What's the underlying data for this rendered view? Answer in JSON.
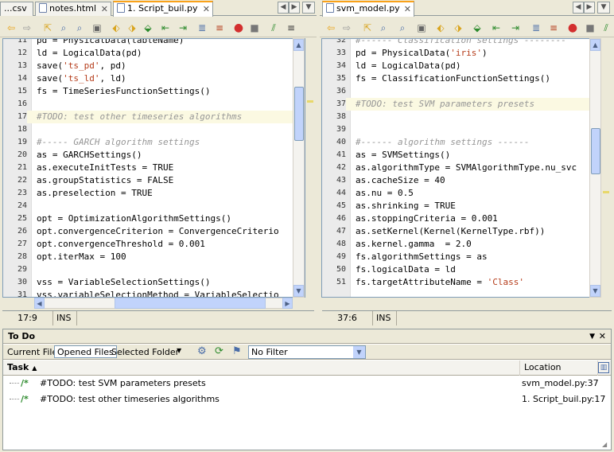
{
  "left": {
    "tabs": [
      "...csv",
      "notes.html",
      "1. Script_buil.py"
    ],
    "active_tab": 2,
    "lines": [
      {
        "n": "11",
        "t": [
          [
            "pd = PhysicalData(tableName)",
            ""
          ]
        ]
      },
      {
        "n": "12",
        "t": [
          [
            "ld = LogicalData(pd)",
            ""
          ]
        ]
      },
      {
        "n": "13",
        "t": [
          [
            "save(",
            ""
          ],
          [
            "'ts_pd'",
            "str"
          ],
          [
            ", pd)",
            ""
          ]
        ]
      },
      {
        "n": "14",
        "t": [
          [
            "save(",
            ""
          ],
          [
            "'ts_ld'",
            "str"
          ],
          [
            ", ld)",
            ""
          ]
        ]
      },
      {
        "n": "15",
        "t": [
          [
            "fs = TimeSeriesFunctionSettings()",
            ""
          ]
        ]
      },
      {
        "n": "16",
        "t": [
          [
            "",
            ""
          ]
        ]
      },
      {
        "n": "17",
        "t": [
          [
            "#TODO: test other timeseries algorithms",
            "cm"
          ]
        ],
        "hl": true
      },
      {
        "n": "18",
        "t": [
          [
            "",
            ""
          ]
        ]
      },
      {
        "n": "19",
        "t": [
          [
            "#----- GARCH algorithm settings",
            "cm"
          ]
        ]
      },
      {
        "n": "20",
        "t": [
          [
            "as = GARCHSettings()",
            ""
          ]
        ]
      },
      {
        "n": "21",
        "t": [
          [
            "as.executeInitTests = TRUE",
            ""
          ]
        ]
      },
      {
        "n": "22",
        "t": [
          [
            "as.groupStatistics = FALSE",
            ""
          ]
        ]
      },
      {
        "n": "23",
        "t": [
          [
            "as.preselection = TRUE",
            ""
          ]
        ]
      },
      {
        "n": "24",
        "t": [
          [
            "",
            ""
          ]
        ]
      },
      {
        "n": "25",
        "t": [
          [
            "opt = OptimizationAlgorithmSettings()",
            ""
          ]
        ]
      },
      {
        "n": "26",
        "t": [
          [
            "opt.convergenceCriterion = ConvergenceCriterio",
            ""
          ]
        ]
      },
      {
        "n": "27",
        "t": [
          [
            "opt.convergenceThreshold = 0.001",
            ""
          ]
        ]
      },
      {
        "n": "28",
        "t": [
          [
            "opt.iterMax = 100",
            ""
          ]
        ]
      },
      {
        "n": "29",
        "t": [
          [
            "",
            ""
          ]
        ]
      },
      {
        "n": "30",
        "t": [
          [
            "vss = VariableSelectionSettings()",
            ""
          ]
        ]
      },
      {
        "n": "31",
        "t": [
          [
            "vss.variableSelectionMethod = VariableSelectio",
            ""
          ]
        ]
      }
    ],
    "status": {
      "pos": "17:9",
      "mode": "INS"
    }
  },
  "right": {
    "tabs": [
      "svm_model.py"
    ],
    "active_tab": 0,
    "lines": [
      {
        "n": "32",
        "t": [
          [
            "#------ Classification settings --------",
            "cm"
          ]
        ]
      },
      {
        "n": "33",
        "t": [
          [
            "pd = PhysicalData(",
            ""
          ],
          [
            "'iris'",
            "str"
          ],
          [
            ")",
            ""
          ]
        ]
      },
      {
        "n": "34",
        "t": [
          [
            "ld = LogicalData(pd)",
            ""
          ]
        ]
      },
      {
        "n": "35",
        "t": [
          [
            "fs = ClassificationFunctionSettings()",
            ""
          ]
        ]
      },
      {
        "n": "36",
        "t": [
          [
            "",
            ""
          ]
        ]
      },
      {
        "n": "37",
        "t": [
          [
            "#TODO: test SVM parameters presets",
            "cm"
          ]
        ],
        "hl": true
      },
      {
        "n": "38",
        "t": [
          [
            "",
            ""
          ]
        ]
      },
      {
        "n": "39",
        "t": [
          [
            "",
            ""
          ]
        ]
      },
      {
        "n": "40",
        "t": [
          [
            "#------ algorithm settings ------",
            "cm"
          ]
        ]
      },
      {
        "n": "41",
        "t": [
          [
            "as = SVMSettings()",
            ""
          ]
        ]
      },
      {
        "n": "42",
        "t": [
          [
            "as.algorithmType = SVMAlgorithmType.nu_svc",
            ""
          ]
        ]
      },
      {
        "n": "43",
        "t": [
          [
            "as.cacheSize = 40",
            ""
          ]
        ]
      },
      {
        "n": "44",
        "t": [
          [
            "as.nu = 0.5",
            ""
          ]
        ]
      },
      {
        "n": "45",
        "t": [
          [
            "as.shrinking = TRUE",
            ""
          ]
        ]
      },
      {
        "n": "46",
        "t": [
          [
            "as.stoppingCriteria = 0.001",
            ""
          ]
        ]
      },
      {
        "n": "47",
        "t": [
          [
            "as.setKernel(Kernel(KernelType.rbf))",
            ""
          ]
        ]
      },
      {
        "n": "48",
        "t": [
          [
            "as.kernel.gamma  = 2.0",
            ""
          ]
        ]
      },
      {
        "n": "49",
        "t": [
          [
            "fs.algorithmSettings = as",
            ""
          ]
        ]
      },
      {
        "n": "50",
        "t": [
          [
            "fs.logicalData = ld",
            ""
          ]
        ]
      },
      {
        "n": "51",
        "t": [
          [
            "fs.targetAttributeName = ",
            ""
          ],
          [
            "'Class'",
            "str"
          ]
        ]
      }
    ],
    "status": {
      "pos": "37:6",
      "mode": "INS"
    }
  },
  "todo": {
    "title": "To Do",
    "scopes": [
      "Current File",
      "Opened Files",
      "Selected Folder"
    ],
    "selected_scope": "Opened Files",
    "filter": "No Filter",
    "col_task": "Task",
    "col_location": "Location",
    "rows": [
      {
        "task": "#TODO: test SVM parameters presets",
        "location": "svm_model.py:37"
      },
      {
        "task": "#TODO: test other timeseries algorithms",
        "location": "1. Script_buil.py:17"
      }
    ]
  }
}
